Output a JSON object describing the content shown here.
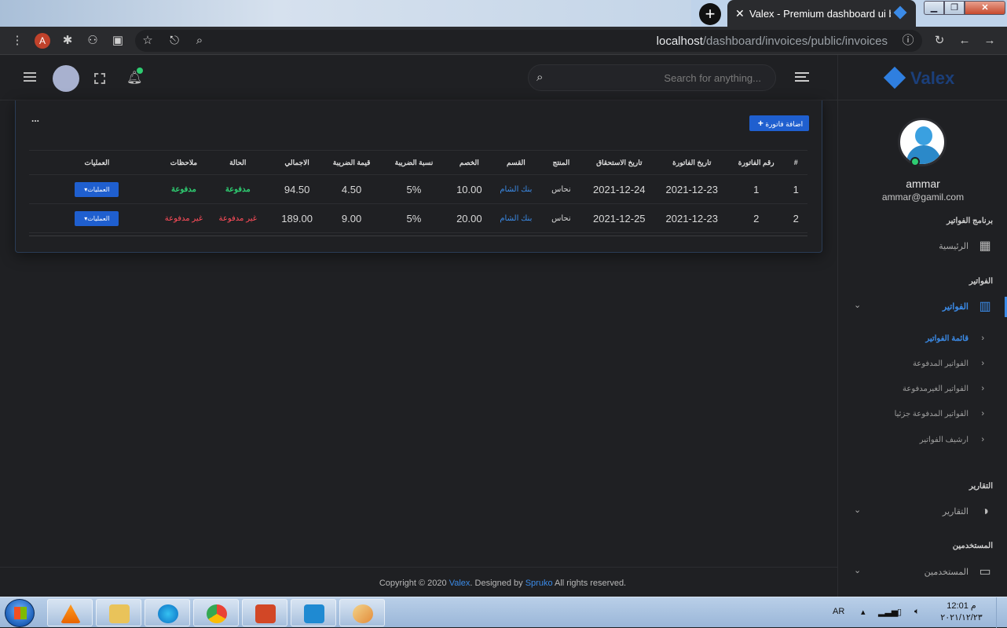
{
  "browser": {
    "tab_title": "Valex - Premium dashboard ui bo",
    "url_host": "localhost",
    "url_path": "/dashboard/invoices/public/invoices",
    "profile_initial": "A"
  },
  "header": {
    "search_placeholder": "Search for anything..."
  },
  "sidebar": {
    "logo": "Valex",
    "user_name": "ammar",
    "user_email": "ammar@gamil.com",
    "sections": [
      {
        "title": "برنامج الفواتير",
        "items": [
          {
            "label": "الرئيسية",
            "icon": "grid-icon"
          }
        ]
      },
      {
        "title": "الفواتير",
        "items": [
          {
            "label": "الفواتير",
            "icon": "chart-icon",
            "active": true
          }
        ]
      },
      {
        "title": "التقارير",
        "items": [
          {
            "label": "التقارير",
            "icon": "pie-icon"
          }
        ]
      },
      {
        "title": "المستخدمين",
        "items": [
          {
            "label": "المستخدمين",
            "icon": "chat-icon"
          }
        ]
      }
    ],
    "invoice_subitems": [
      {
        "label": "قائمة الفواتير",
        "active": true
      },
      {
        "label": "الفواتير المدفوعة"
      },
      {
        "label": "الفواتير الغيرمدفوعة"
      },
      {
        "label": "الفواتير المدفوعة جزئيا"
      },
      {
        "label": "ارشيف الفواتير"
      }
    ]
  },
  "card": {
    "add_invoice_label": "اضافة فاتورة",
    "more": "...",
    "columns": [
      "#",
      "رقم الفاتورة",
      "تاريخ الفاتورة",
      "تاريخ الاستحقاق",
      "المنتج",
      "القسم",
      "الخصم",
      "نسبة الضريبة",
      "قيمة الضريبة",
      "الاجمالي",
      "الحالة",
      "ملاحظات",
      "العمليات"
    ],
    "rows": [
      {
        "idx": "1",
        "number": "1",
        "date": "2021-12-23",
        "due": "2021-12-24",
        "product": "نحاس",
        "section": "بنك الشام",
        "discount": "10.00",
        "rate": "5%",
        "vat": "4.50",
        "total": "94.50",
        "status": "مدفوعة",
        "notes": "مدفوعة",
        "ops": "العمليات",
        "paid": true
      },
      {
        "idx": "2",
        "number": "2",
        "date": "2021-12-23",
        "due": "2021-12-25",
        "product": "نحاس",
        "section": "بنك الشام",
        "discount": "20.00",
        "rate": "5%",
        "vat": "9.00",
        "total": "189.00",
        "status": "غير مدفوعة",
        "notes": "غير مدفوعة",
        "ops": "العمليات",
        "paid": false
      }
    ]
  },
  "footer": {
    "prefix": "Copyright © 2020 ",
    "brand": "Valex",
    "mid": ". Designed by ",
    "designer": "Spruko",
    "suffix": " All rights reserved."
  },
  "taskbar": {
    "lang": "AR",
    "time": "12:01 م",
    "date": "٢٠٢١/١٢/٢٣"
  },
  "colors": {
    "accent": "#1f5fcf",
    "link": "#3b8be8",
    "paid": "#2ecc71",
    "unpaid": "#ff4d5a"
  }
}
